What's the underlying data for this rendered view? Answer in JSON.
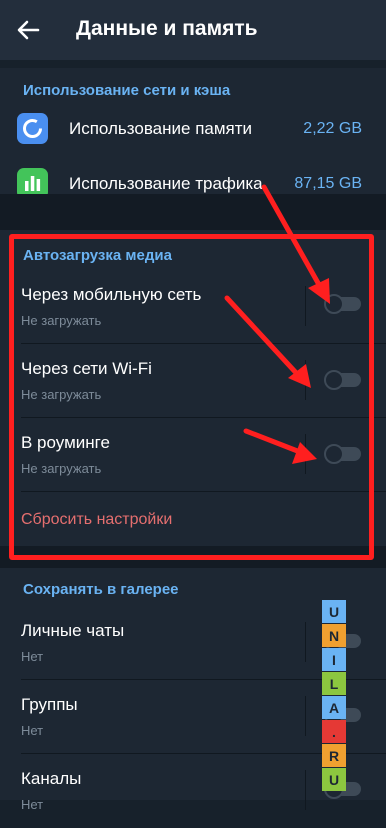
{
  "header": {
    "title": "Данные и память"
  },
  "usage": {
    "heading": "Использование сети и кэша",
    "items": [
      {
        "label": "Использование памяти",
        "value": "2,22 GB",
        "icon": "storage-pie-icon",
        "color": "#4a8ff0"
      },
      {
        "label": "Использование трафика",
        "value": "87,15 GB",
        "icon": "bar-chart-icon",
        "color": "#43c45a"
      }
    ]
  },
  "autodownload": {
    "heading": "Автозагрузка медиа",
    "items": [
      {
        "label": "Через мобильную сеть",
        "sub": "Не загружать",
        "enabled": false
      },
      {
        "label": "Через сети Wi-Fi",
        "sub": "Не загружать",
        "enabled": false
      },
      {
        "label": "В роуминге",
        "sub": "Не загружать",
        "enabled": false
      }
    ],
    "reset": "Сбросить настройки"
  },
  "gallery": {
    "heading": "Сохранять в галерее",
    "items": [
      {
        "label": "Личные чаты",
        "sub": "Нет",
        "enabled": false
      },
      {
        "label": "Группы",
        "sub": "Нет",
        "enabled": false
      },
      {
        "label": "Каналы",
        "sub": "Нет",
        "enabled": false
      }
    ]
  },
  "watermark": {
    "letters": [
      "U",
      "N",
      "I",
      "L",
      "A",
      ".",
      "R",
      "U"
    ],
    "colors": [
      "#6ab3f3",
      "#f0a030",
      "#6ab3f3",
      "#8cc63f",
      "#6ab3f3",
      "#e53935",
      "#f0a030",
      "#8cc63f"
    ]
  },
  "colors": {
    "accent": "#6ab3f3",
    "danger": "#e56f6f",
    "annotation": "#ff1f1f"
  }
}
